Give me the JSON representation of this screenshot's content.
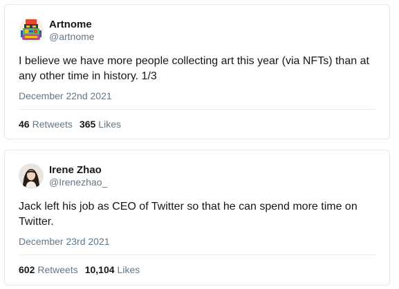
{
  "tweets": [
    {
      "display_name": "Artnome",
      "handle": "@artnome",
      "avatar_icon": "artnome-logo-avatar",
      "text": "I believe we have more people collecting art this year (via NFTs) than at any other time in history. 1/3",
      "date": "December 22nd 2021",
      "retweets_count": "46",
      "retweets_label": "Retweets",
      "likes_count": "365",
      "likes_label": "Likes"
    },
    {
      "display_name": "Irene Zhao",
      "handle": "@Irenezhao_",
      "avatar_icon": "profile-photo-avatar",
      "text": "Jack left his job as CEO of Twitter so that he can spend more time on Twitter.",
      "date": "December 23rd 2021",
      "retweets_count": "602",
      "retweets_label": "Retweets",
      "likes_count": "10,104",
      "likes_label": "Likes"
    }
  ],
  "colors": {
    "text_primary": "#14171a",
    "text_secondary": "#657786",
    "border": "#e1e8ed"
  }
}
